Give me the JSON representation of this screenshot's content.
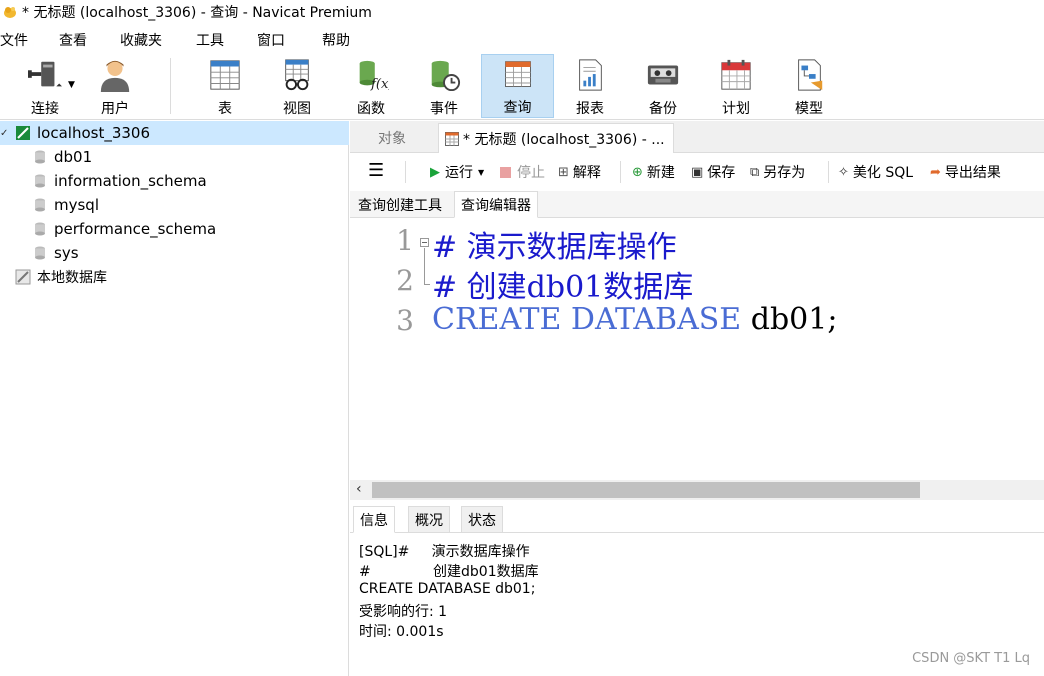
{
  "window": {
    "title": "* 无标题 (localhost_3306) - 查询 - Navicat Premium"
  },
  "menu": [
    "文件",
    "查看",
    "收藏夹",
    "工具",
    "窗口",
    "帮助"
  ],
  "toolbar": [
    {
      "label": "连接",
      "icon": "connection-icon"
    },
    {
      "label": "用户",
      "icon": "user-icon"
    },
    {
      "label": "表",
      "icon": "table-icon"
    },
    {
      "label": "视图",
      "icon": "view-icon"
    },
    {
      "label": "函数",
      "icon": "function-icon"
    },
    {
      "label": "事件",
      "icon": "event-icon"
    },
    {
      "label": "查询",
      "icon": "query-icon",
      "active": true
    },
    {
      "label": "报表",
      "icon": "report-icon"
    },
    {
      "label": "备份",
      "icon": "backup-icon"
    },
    {
      "label": "计划",
      "icon": "schedule-icon"
    },
    {
      "label": "模型",
      "icon": "model-icon"
    }
  ],
  "tree": {
    "connection": "localhost_3306",
    "databases": [
      "db01",
      "information_schema",
      "mysql",
      "performance_schema",
      "sys"
    ],
    "local": "本地数据库"
  },
  "tabs": {
    "objects": "对象",
    "query": "* 无标题 (localhost_3306) - ..."
  },
  "query_toolbar": {
    "run": "运行",
    "stop": "停止",
    "explain": "解释",
    "new": "新建",
    "save": "保存",
    "save_as": "另存为",
    "beautify": "美化 SQL",
    "export": "导出结果"
  },
  "subtabs": {
    "builder": "查询创建工具",
    "editor": "查询编辑器"
  },
  "editor": {
    "lines": [
      {
        "num": "1",
        "comment": "#  演示数据库操作"
      },
      {
        "num": "2",
        "comment": "#  创建db01数据库"
      },
      {
        "num": "3",
        "kw1": "CREATE",
        "kw2": "DATABASE",
        "rest": "db01;"
      }
    ]
  },
  "result_tabs": {
    "info": "信息",
    "profile": "概况",
    "status": "状态"
  },
  "results": [
    "[SQL]#     演示数据库操作",
    "#              创建db01数据库",
    "CREATE DATABASE db01;",
    "受影响的行: 1",
    "时间: 0.001s"
  ],
  "watermark": "CSDN @SKT T1 Lq",
  "colors": {
    "comment": "#1a1acc",
    "keyword": "#4a6cd4",
    "selected_row": "#cce8ff",
    "active_tool": "#cce4f7"
  }
}
